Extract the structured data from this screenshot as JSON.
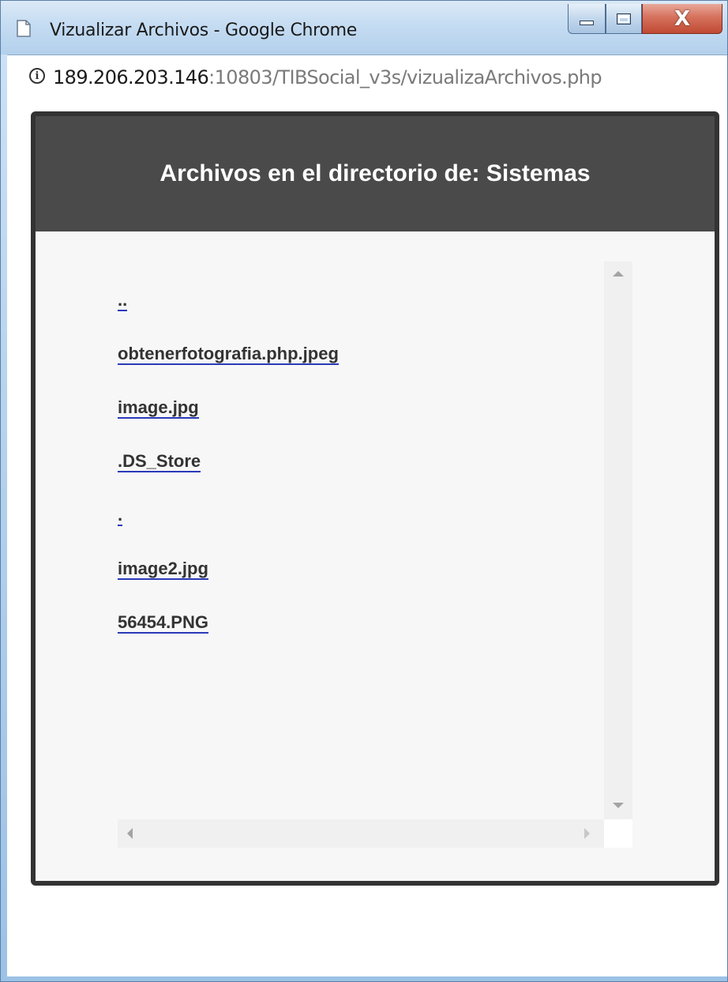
{
  "window": {
    "title": "Vizualizar Archivos - Google Chrome",
    "close_glyph": "X"
  },
  "address": {
    "host": "189.206.203.146",
    "rest": ":10803/TIBSocial_v3s/vizualizaArchivos.php",
    "info_glyph": "i"
  },
  "modal": {
    "title": "Archivos en el directorio de: Sistemas"
  },
  "files": [
    "..",
    "obtenerfotografia.php.jpeg",
    "image.jpg",
    ".DS_Store",
    ".",
    "image2.jpg",
    "56454.PNG"
  ],
  "icons": {
    "page": "document-icon",
    "info": "info-icon",
    "minimize": "minimize-icon",
    "maximize": "maximize-icon",
    "close": "close-icon"
  },
  "colors": {
    "header_bg": "#4a4a4a",
    "modal_border": "#333333",
    "link_underline": "#2a3ab8",
    "close_button": "#c14a33"
  }
}
